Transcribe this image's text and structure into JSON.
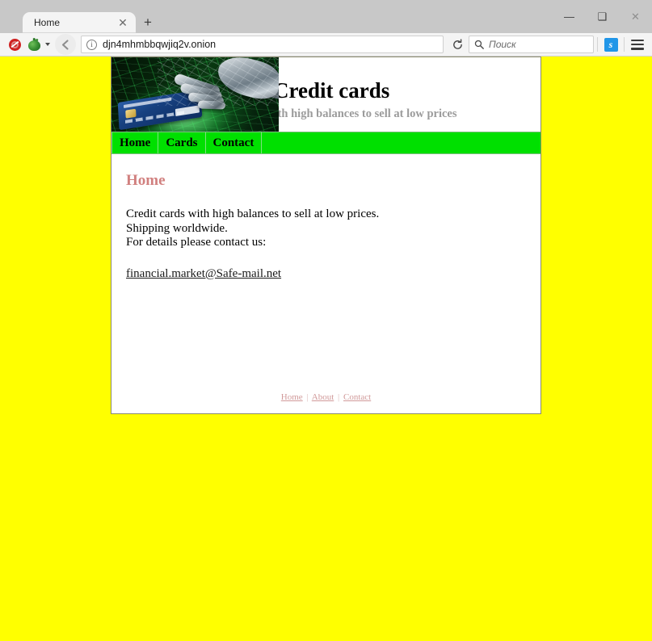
{
  "browser": {
    "tab": {
      "title": "Home",
      "close_icon": "close-icon"
    },
    "new_tab_label": "+",
    "window_controls": {
      "minimize": "—",
      "maximize": "❑",
      "close": "✕"
    },
    "toolbar": {
      "noscript_icon": "noscript-icon",
      "torbutton_icon": "onion-icon",
      "back_icon": "back-arrow-icon",
      "site_info_icon": "info-icon",
      "url": "djn4mhmbbqwjiq2v.onion",
      "reload_icon": "reload-icon",
      "search_icon": "search-icon",
      "search_placeholder": "Поиск",
      "search_value": "",
      "extension_icon_label": "s",
      "menu_icon": "hamburger-menu-icon"
    }
  },
  "site": {
    "title": "Credit cards",
    "subtitle": "Credit cards with high balances to sell at low prices",
    "banner_alt": "credit-card-robotic-hand-banner",
    "nav": [
      {
        "label": "Home"
      },
      {
        "label": "Cards"
      },
      {
        "label": "Contact"
      }
    ],
    "content": {
      "heading": "Home",
      "lines": [
        "Credit cards with high balances to sell at low prices.",
        "Shipping worldwide.",
        "For details please contact us:"
      ],
      "email": "financial.market@Safe-mail.net"
    },
    "footer": {
      "links": [
        {
          "label": "Home"
        },
        {
          "label": "About"
        },
        {
          "label": "Contact"
        }
      ],
      "separator": "|"
    }
  },
  "colors": {
    "page_background": "#ffff00",
    "nav_green": "#00e000",
    "heading_rose": "#d1807f",
    "footer_rose": "#d19a9a",
    "subtitle_gray": "#9b9b9b"
  }
}
